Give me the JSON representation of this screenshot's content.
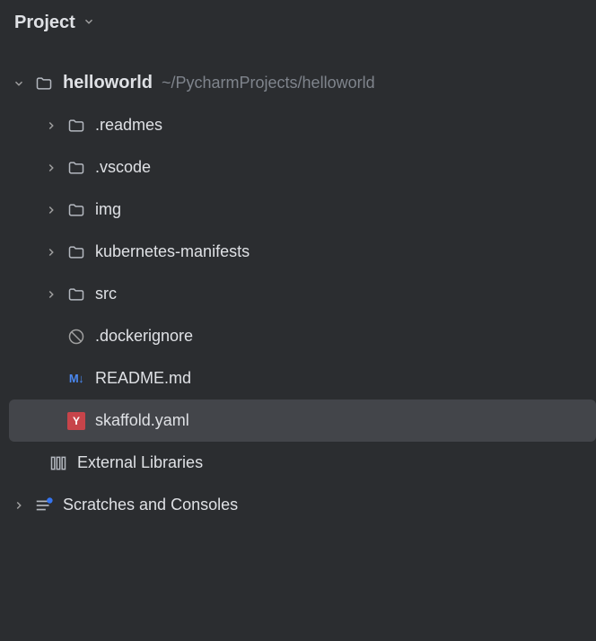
{
  "header": {
    "title": "Project"
  },
  "tree": {
    "root": {
      "name": "helloworld",
      "path": "~/PycharmProjects/helloworld"
    },
    "folders": [
      {
        "name": ".readmes"
      },
      {
        "name": ".vscode"
      },
      {
        "name": "img"
      },
      {
        "name": "kubernetes-manifests"
      },
      {
        "name": "src"
      }
    ],
    "files": {
      "dockerignore": ".dockerignore",
      "readme": "README.md",
      "skaffold": "skaffold.yaml"
    },
    "externalLibraries": "External Libraries",
    "scratches": "Scratches and Consoles"
  },
  "icons": {
    "markdown": "M↓",
    "yaml": "Y"
  }
}
